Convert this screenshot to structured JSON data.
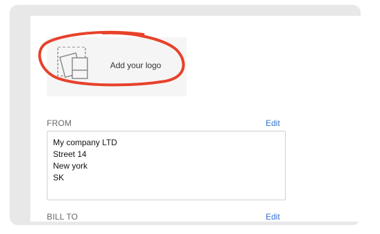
{
  "logo_area": {
    "label": "Add your logo",
    "icon": "image-placeholder-icon"
  },
  "from_section": {
    "label": "FROM",
    "edit_label": "Edit",
    "address_lines": [
      "My company LTD",
      "Street 14",
      "New york",
      "SK"
    ]
  },
  "bill_to_section": {
    "label": "BILL TO",
    "edit_label": "Edit"
  },
  "colors": {
    "annotation": "#e8412a",
    "link": "#2f6fd1",
    "frame": "#e8e8e8"
  }
}
